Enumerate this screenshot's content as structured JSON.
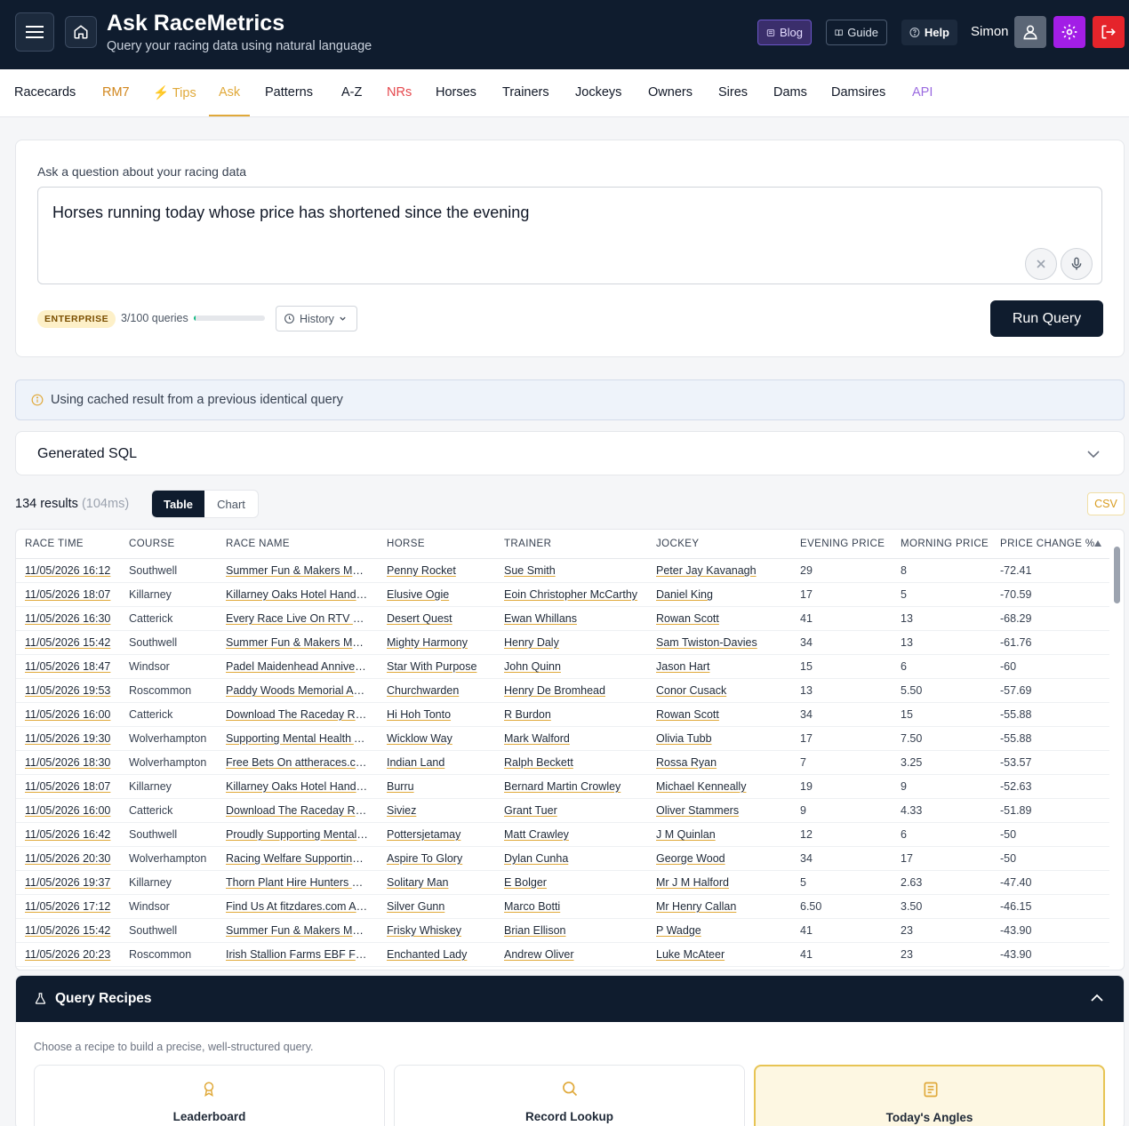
{
  "header": {
    "title": "Ask RaceMetrics",
    "subtitle": "Query your racing data using natural language",
    "blog_label": "Blog",
    "guide_label": "Guide",
    "help_label": "Help",
    "user_name": "Simon"
  },
  "nav": {
    "items": [
      {
        "label": "Racecards",
        "color": "#111827"
      },
      {
        "label": "RM7",
        "color": "#d1861c"
      },
      {
        "label": "Tips",
        "color": "#e0a93a"
      },
      {
        "label": "Ask",
        "color": "#e0a93a",
        "active": true
      },
      {
        "label": "Patterns",
        "color": "#111827"
      },
      {
        "label": "A-Z",
        "color": "#111827"
      },
      {
        "label": "NRs",
        "color": "#e5484d"
      },
      {
        "label": "Horses",
        "color": "#111827"
      },
      {
        "label": "Trainers",
        "color": "#111827"
      },
      {
        "label": "Jockeys",
        "color": "#111827"
      },
      {
        "label": "Owners",
        "color": "#111827"
      },
      {
        "label": "Sires",
        "color": "#111827"
      },
      {
        "label": "Dams",
        "color": "#111827"
      },
      {
        "label": "Damsires",
        "color": "#111827"
      },
      {
        "label": "API",
        "color": "#9b6be0"
      }
    ]
  },
  "query": {
    "label": "Ask a question about your racing data",
    "text": "Horses running today whose price has shortened since the evening",
    "plan": "ENTERPRISE",
    "count": "3/100 queries",
    "usage_fraction": 0.03,
    "history_label": "History",
    "run_label": "Run Query"
  },
  "info": {
    "message": "Using cached result from a previous identical query"
  },
  "sql": {
    "title": "Generated SQL"
  },
  "results": {
    "count": "134 results",
    "time": "(104ms)",
    "table_label": "Table",
    "chart_label": "Chart",
    "csv_label": "CSV",
    "columns": [
      "RACE TIME",
      "COURSE",
      "RACE NAME",
      "HORSE",
      "TRAINER",
      "JOCKEY",
      "EVENING PRICE",
      "MORNING PRICE",
      "PRICE CHANGE %"
    ],
    "rows": [
      [
        "11/05/2026 16:12",
        "Southwell",
        "Summer Fun & Makers Market",
        "Penny Rocket",
        "Sue Smith",
        "Peter Jay Kavanagh",
        "29",
        "8",
        "-72.41"
      ],
      [
        "11/05/2026 18:07",
        "Killarney",
        "Killarney Oaks Hotel Handicap",
        "Elusive Ogie",
        "Eoin Christopher McCarthy",
        "Daniel King",
        "17",
        "5",
        "-70.59"
      ],
      [
        "11/05/2026 16:30",
        "Catterick",
        "Every Race Live On RTV Handicap",
        "Desert Quest",
        "Ewan Whillans",
        "Rowan Scott",
        "41",
        "13",
        "-68.29"
      ],
      [
        "11/05/2026 15:42",
        "Southwell",
        "Summer Fun & Makers Market",
        "Mighty Harmony",
        "Henry Daly",
        "Sam Twiston-Davies",
        "34",
        "13",
        "-61.76"
      ],
      [
        "11/05/2026 18:47",
        "Windsor",
        "Padel Maidenhead Anniversary",
        "Star With Purpose",
        "John Quinn",
        "Jason Hart",
        "15",
        "6",
        "-60"
      ],
      [
        "11/05/2026 19:53",
        "Roscommon",
        "Paddy Woods Memorial Apprentice",
        "Churchwarden",
        "Henry De Bromhead",
        "Conor Cusack",
        "13",
        "5.50",
        "-57.69"
      ],
      [
        "11/05/2026 16:00",
        "Catterick",
        "Download The Raceday Ready App",
        "Hi Hoh Tonto",
        "R Burdon",
        "Rowan Scott",
        "34",
        "15",
        "-55.88"
      ],
      [
        "11/05/2026 19:30",
        "Wolverhampton",
        "Supporting Mental Health Awareness",
        "Wicklow Way",
        "Mark Walford",
        "Olivia Tubb",
        "17",
        "7.50",
        "-55.88"
      ],
      [
        "11/05/2026 18:30",
        "Wolverhampton",
        "Free Bets On attheraces.com",
        "Indian Land",
        "Ralph Beckett",
        "Rossa Ryan",
        "7",
        "3.25",
        "-53.57"
      ],
      [
        "11/05/2026 18:07",
        "Killarney",
        "Killarney Oaks Hotel Handicap",
        "Burru",
        "Bernard Martin Crowley",
        "Michael Kenneally",
        "19",
        "9",
        "-52.63"
      ],
      [
        "11/05/2026 16:00",
        "Catterick",
        "Download The Raceday Ready App",
        "Siviez",
        "Grant Tuer",
        "Oliver Stammers",
        "9",
        "4.33",
        "-51.89"
      ],
      [
        "11/05/2026 16:42",
        "Southwell",
        "Proudly Supporting Mental Health",
        "Pottersjetamay",
        "Matt Crawley",
        "J M Quinlan",
        "12",
        "6",
        "-50"
      ],
      [
        "11/05/2026 20:30",
        "Wolverhampton",
        "Racing Welfare Supporting Stable Staff",
        "Aspire To Glory",
        "Dylan Cunha",
        "George Wood",
        "34",
        "17",
        "-50"
      ],
      [
        "11/05/2026 19:37",
        "Killarney",
        "Thorn Plant Hire Hunters Chase",
        "Solitary Man",
        "E Bolger",
        "Mr J M Halford",
        "5",
        "2.63",
        "-47.40"
      ],
      [
        "11/05/2026 17:12",
        "Windsor",
        "Find Us At fitzdares.com Amateur",
        "Silver Gunn",
        "Marco Botti",
        "Mr Henry Callan",
        "6.50",
        "3.50",
        "-46.15"
      ],
      [
        "11/05/2026 15:42",
        "Southwell",
        "Summer Fun & Makers Market",
        "Frisky Whiskey",
        "Brian Ellison",
        "P Wadge",
        "41",
        "23",
        "-43.90"
      ],
      [
        "11/05/2026 20:23",
        "Roscommon",
        "Irish Stallion Farms EBF Fillies Maiden",
        "Enchanted Lady",
        "Andrew Oliver",
        "Luke McAteer",
        "41",
        "23",
        "-43.90"
      ]
    ]
  },
  "recipes": {
    "title": "Query Recipes",
    "description": "Choose a recipe to build a precise, well-structured query.",
    "items": [
      {
        "label": "Leaderboard",
        "icon": "award-icon"
      },
      {
        "label": "Record Lookup",
        "icon": "search-icon"
      },
      {
        "label": "Today's Angles",
        "icon": "document-icon",
        "active": true
      }
    ]
  },
  "colors": {
    "header_bg": "#0f1c2e",
    "accent": "#e0a93a",
    "settings": "#a21ee6",
    "logout": "#e5242b"
  }
}
